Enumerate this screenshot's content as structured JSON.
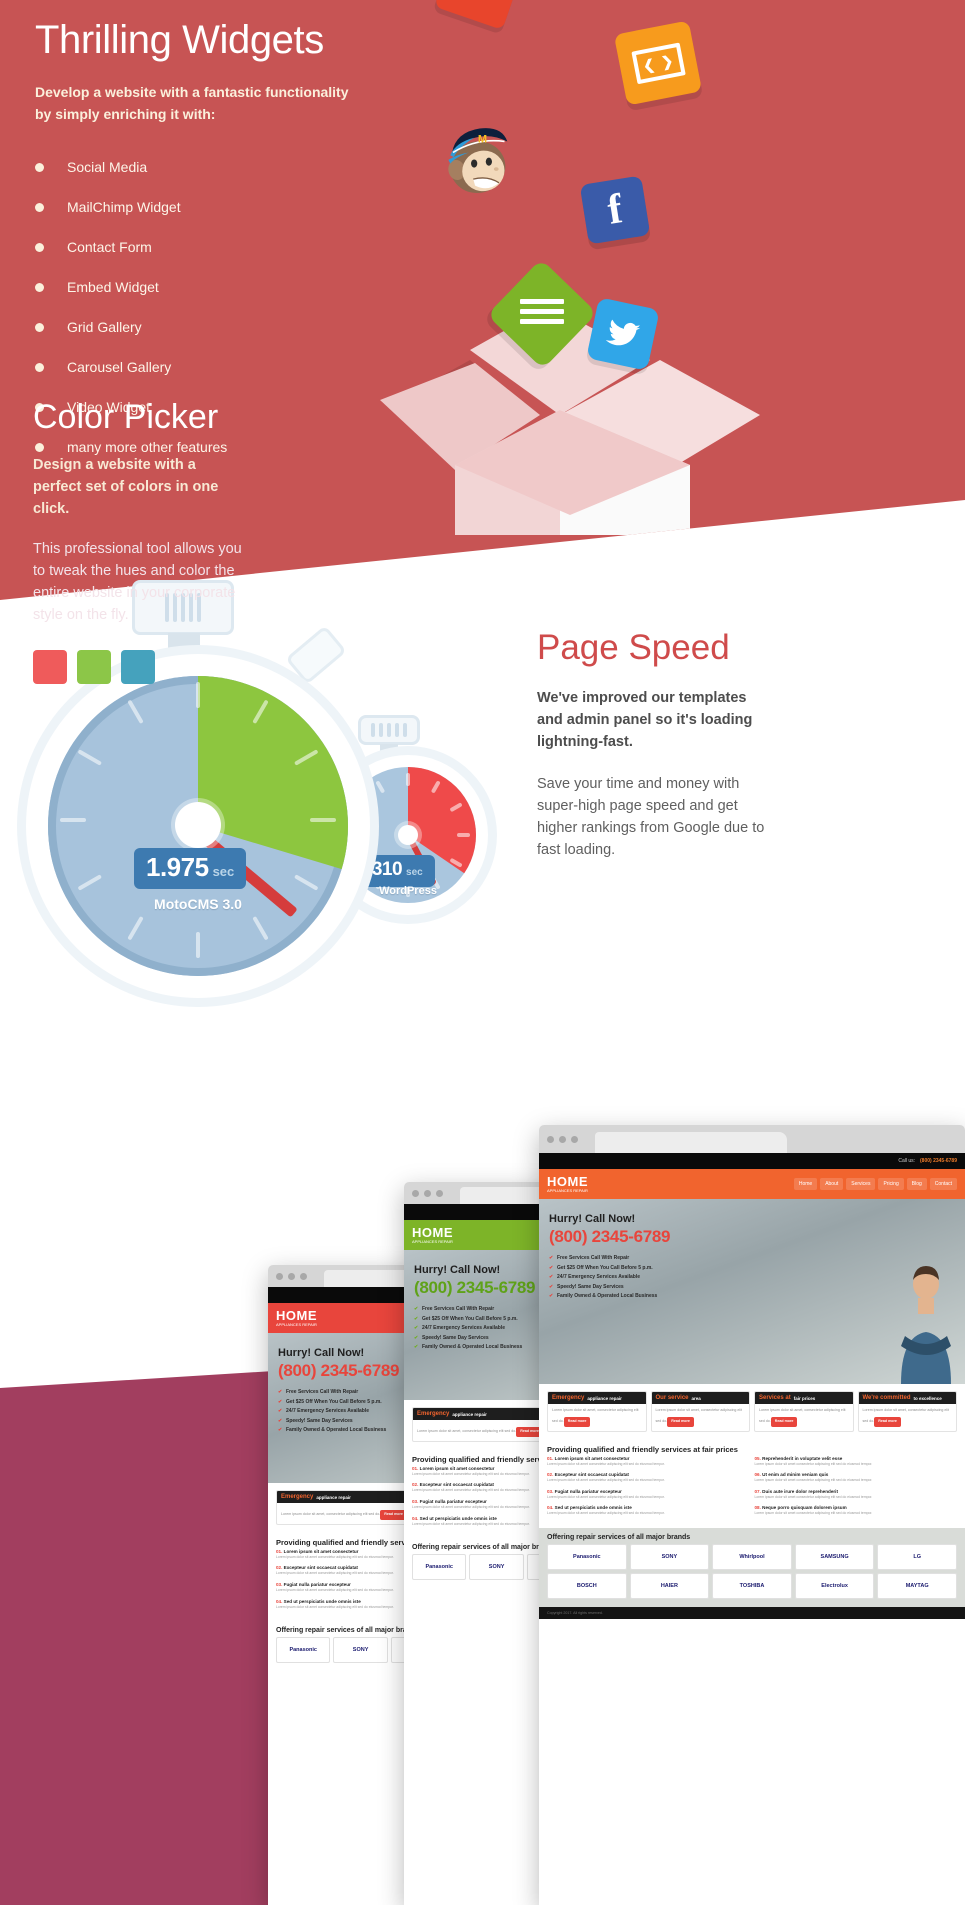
{
  "widgets": {
    "title": "Thrilling Widgets",
    "subtitle": "Develop a website with a fantastic functionality by simply enriching it with:",
    "features": [
      "Social Media",
      "MailChimp Widget",
      "Contact Form",
      "Embed Widget",
      "Grid Gallery",
      "Carousel Gallery",
      "Video Widget",
      "many more other features"
    ],
    "icons": {
      "facebook": "f",
      "twitter": "🐦",
      "embed": "‹›"
    },
    "background_color": "#c75454"
  },
  "page_speed": {
    "title": "Page Speed",
    "lead": "We've improved our templates and admin panel so it's loading lightning-fast.",
    "body": "Save your time and money with super-high page speed and get higher rankings from Google due to fast loading.",
    "title_color": "#cf4b4b",
    "stopwatch_primary": {
      "value": "1.975",
      "unit": "sec",
      "label": "MotoCMS 3.0",
      "dial_color": "#8dc63f"
    },
    "stopwatch_secondary": {
      "value": "3.310",
      "unit": "sec",
      "label": "WordPress",
      "dial_color": "#ef4a4a"
    }
  },
  "color_picker": {
    "title": "Color Picker",
    "lead": "Design a website with a perfect set of colors in one click.",
    "body": "This professional tool allows you to tweak the hues and color the entire website in your corporate style on the fly.",
    "swatches": [
      "#ef5b5b",
      "#8cc648",
      "#45a2bd"
    ],
    "background_color": "#a23e5f"
  },
  "mockups": [
    {
      "id": "mockup-red",
      "accent": "#e8453c",
      "nav_color": "#e8453c",
      "logo": "HOME",
      "logo_sub": "APPLIANCES REPAIR",
      "phone_label": "Call us:",
      "phone": "(800) 2345-6789",
      "menu": [
        "Home",
        "About",
        "Services",
        "Pricing",
        "Blog",
        "Contact"
      ],
      "hero_kicker": "Hurry! Call Now!",
      "hero_phone": "(800) 2345-6789",
      "hero_bullets": [
        "Free Services Call With Repair",
        "Get $25 Off When You Call Before 5 p.m.",
        "24/7 Emergency Services Available",
        "Speedy! Same Day Services",
        "Family Owned & Operated Local Business"
      ],
      "cards": [
        {
          "name": "Emergency",
          "title": "appliance repair",
          "body": "Lorem ipsum dolor sit amet, consectetur adipiscing elit sed do.",
          "btn": "Read more"
        },
        {
          "name": "Our service",
          "title": "area",
          "body": "Lorem ipsum dolor sit amet, consectetur adipiscing elit sed do.",
          "btn": "Read more"
        },
        {
          "name": "Services at",
          "title": "fair prices",
          "body": "Lorem ipsum dolor sit amet, consectetur adipiscing elit sed do.",
          "btn": "Read more"
        },
        {
          "name": "We're committed",
          "title": "to excellence",
          "body": "Lorem ipsum dolor sit amet, consectetur adipiscing elit sed do.",
          "btn": "Read more"
        }
      ],
      "section_title": "Providing qualified and friendly services at fair prices",
      "numbered": [
        {
          "n": "01.",
          "t": "Lorem ipsum sit amet consectetur",
          "d": "Lorem ipsum dolor sit amet consectetur adipiscing elit sed do eiusmod tempor."
        },
        {
          "n": "05.",
          "t": "Reprehenderit in voluptate velit esse",
          "d": "Lorem ipsum dolor sit amet consectetur adipiscing elit sed do eiusmod tempor."
        },
        {
          "n": "02.",
          "t": "Excepteur sint occaecat cupidatat",
          "d": "Lorem ipsum dolor sit amet consectetur adipiscing elit sed do eiusmod tempor."
        },
        {
          "n": "06.",
          "t": "Ut enim ad minim veniam quis",
          "d": "Lorem ipsum dolor sit amet consectetur adipiscing elit sed do eiusmod tempor."
        },
        {
          "n": "03.",
          "t": "Fugiat nulla pariatur excepteur",
          "d": "Lorem ipsum dolor sit amet consectetur adipiscing elit sed do eiusmod tempor."
        },
        {
          "n": "07.",
          "t": "Duis aute irure dolor reprehenderit",
          "d": "Lorem ipsum dolor sit amet consectetur adipiscing elit sed do eiusmod tempor."
        },
        {
          "n": "04.",
          "t": "Sed ut perspiciatis unde omnis iste",
          "d": "Lorem ipsum dolor sit amet consectetur adipiscing elit sed do eiusmod tempor."
        },
        {
          "n": "08.",
          "t": "Neque porro quisquam dolorem ipsum",
          "d": "Lorem ipsum dolor sit amet consectetur adipiscing elit sed do eiusmod tempor."
        }
      ],
      "brands_title": "Offering repair services of all major brands",
      "brands": [
        "Panasonic",
        "SONY",
        "Whirlpool",
        "SAMSUNG",
        "LG",
        "BOSCH",
        "HAIER",
        "TOSHIBA",
        "Electrolux",
        "MAYTAG"
      ],
      "footer": "Copyright 2017. All rights reserved."
    },
    {
      "id": "mockup-green",
      "accent": "#7db428",
      "nav_color": "#7db428",
      "logo": "HOME",
      "logo_sub": "APPLIANCES REPAIR",
      "hero_kicker": "Hurry! Call Now!",
      "hero_phone": "(800) 2345-6789",
      "section_title": "Providing qualified and friendly services at fair prices",
      "brands_title": "Offering repair services of all major brands"
    },
    {
      "id": "mockup-orange",
      "accent": "#f1642e",
      "nav_color": "#f1642e",
      "logo": "HOME",
      "logo_sub": "APPLIANCES REPAIR",
      "hero_kicker": "Hurry! Call Now!",
      "hero_phone": "(800) 2345-6789",
      "section_title": "Providing qualified and friendly services at fair prices",
      "brands_title": "Offering repair services of all major brands"
    }
  ]
}
